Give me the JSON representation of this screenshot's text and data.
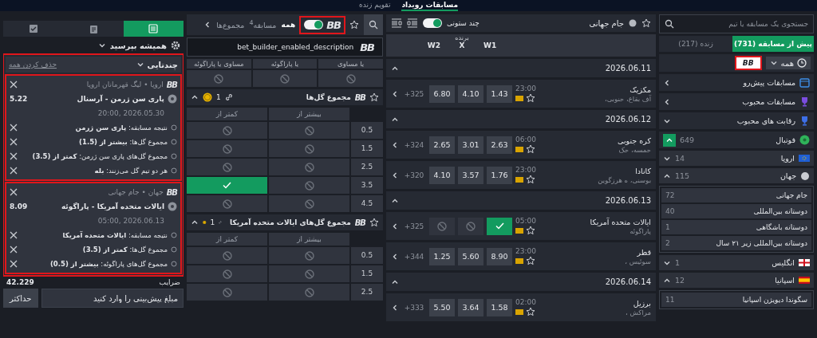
{
  "top_nav": {
    "tabs": [
      {
        "label": "مسابقات رویداد",
        "selected": true
      },
      {
        "label": "تقویم زنده",
        "selected": false
      }
    ]
  },
  "bet_slip": {
    "tabs": [
      {
        "selected": true
      },
      {
        "selected": false
      },
      {
        "selected": false
      }
    ],
    "accept_mode": "همیشه بپرسید",
    "bet_type": "چندتایی",
    "clear_all": "حذف کردن همه",
    "highlighted": true,
    "bets": [
      {
        "badge": "BB",
        "league": "اروپا • لیگ قهرمانان اروپا",
        "match": "پاری سن ژرمن - آرسنال",
        "odds": "5.22",
        "date": "2026.05.30 ,20:00",
        "highlighted": true,
        "selections": [
          "نتیجه مسابقه: **پاری سن ژرمن**",
          "مجموع گل‌ها: **بیشتر از (1.5)**",
          "مجموع گل‌های پاری سن ژرمن: **کمتر از (3.5)**",
          "هر دو تیم گل می‌زنند: **بله**"
        ]
      },
      {
        "badge": "BB",
        "league": "جهان • جام جهانی",
        "match": "ایالات متحده آمریکا - پاراگوئه",
        "odds": "8.09",
        "date": "2026.06.13 ,05:00",
        "highlighted": true,
        "selections": [
          "نتیجه مسابقه: **ایالات متحده آمریکا**",
          "مجموع گل‌ها: **کمتر از (3.5)**",
          "مجموع گل‌های پاراگوئه: **بیشتر از (0.5)**"
        ]
      }
    ],
    "odds_label": "ضرایب",
    "total_odds": "42.229",
    "stake": {
      "placeholder": "مبلغ پیش‌بینی را وارد کنید"
    },
    "max_button": "حداکثر"
  },
  "markets": {
    "badge": "BB",
    "bet_builder_on": true,
    "highlighted": true,
    "tabs": [
      {
        "label": "همه",
        "selected": true
      },
      {
        "label": "مسابقه$^{4}$",
        "selected": false
      },
      {
        "label": "مجموع‌ها",
        "selected": false
      }
    ],
    "description": {
      "badge": "BB",
      "text": "bet_builder_enabled_description"
    },
    "partial_table": {
      "columns": [
        "یا مساوی",
        "یا پاراگوئه",
        "مساوی یا پاراگوئه"
      ]
    },
    "groups": [
      {
        "badge": "BB",
        "title": "مجموع گل‌ها",
        "links": "1",
        "expanded": true,
        "columns": [
          "بیشتر از",
          "کمتر از"
        ],
        "rows": [
          {
            "line": "0.5",
            "cells": [
              {
                "selected": false
              },
              {
                "selected": false
              }
            ]
          },
          {
            "line": "1.5",
            "cells": [
              {
                "selected": false
              },
              {
                "selected": false
              }
            ]
          },
          {
            "line": "2.5",
            "cells": [
              {
                "selected": false
              },
              {
                "selected": false
              }
            ]
          },
          {
            "line": "3.5",
            "cells": [
              {
                "selected": false
              },
              {
                "selected": true
              }
            ]
          },
          {
            "line": "4.5",
            "cells": [
              {
                "selected": false
              },
              {
                "selected": false
              }
            ]
          }
        ]
      },
      {
        "badge": "BB",
        "title": "مجموع گل‌های ایالات متحده آمریکا",
        "links": "1",
        "expanded": true,
        "columns": [
          "بیشتر از",
          "کمتر از"
        ],
        "rows": [
          {
            "line": "0.5",
            "cells": [
              {
                "selected": false
              },
              {
                "selected": false
              }
            ]
          },
          {
            "line": "1.5",
            "cells": [
              {
                "selected": false
              },
              {
                "selected": false
              }
            ]
          },
          {
            "line": "2.5",
            "cells": [
              {
                "selected": false
              },
              {
                "selected": false
              }
            ]
          }
        ]
      }
    ]
  },
  "events": {
    "title": "جام جهانی",
    "multi_column_label": "چند ستونی",
    "multi_column": true,
    "winner_label": "برنده",
    "outcomes": [
      "W1",
      "X",
      "W2"
    ],
    "days": [
      {
        "date": "2026.06.11",
        "expanded": true,
        "matches": [
          {
            "home": "مکزیک",
            "away": "آف بقاع، حنوبی،",
            "time": "23:00",
            "more": "325+",
            "odds": [
              {
                "value": "1.43",
                "selected": false
              },
              {
                "value": "4.10",
                "selected": false
              },
              {
                "value": "6.80",
                "selected": false
              }
            ]
          }
        ]
      },
      {
        "date": "2026.06.12",
        "expanded": true,
        "matches": [
          {
            "home": "کره جنوبی",
            "away": "حمسه، حک",
            "time": "06:00",
            "more": "324+",
            "odds": [
              {
                "value": "2.63",
                "selected": false
              },
              {
                "value": "3.01",
                "selected": false
              },
              {
                "value": "2.65",
                "selected": false
              }
            ]
          },
          {
            "home": "کانادا",
            "away": "بوسنی، ه هرزگوین",
            "time": "23:00",
            "more": "320+",
            "odds": [
              {
                "value": "1.76",
                "selected": false
              },
              {
                "value": "3.57",
                "selected": false
              },
              {
                "value": "4.10",
                "selected": false
              }
            ]
          }
        ]
      },
      {
        "date": "2026.06.13",
        "expanded": true,
        "matches": [
          {
            "home": "ایالات متحده آمریکا",
            "away": "پاراگوئه",
            "time": "05:00",
            "more": "325+",
            "odds": [
              {
                "selected": true
              },
              {
                "selected": false
              },
              {
                "selected": false
              }
            ]
          },
          {
            "home": "قطر",
            "away": "سوئیس ،",
            "time": "23:00",
            "more": "344+",
            "odds": [
              {
                "value": "8.90",
                "selected": false
              },
              {
                "value": "5.60",
                "selected": false
              },
              {
                "value": "1.25",
                "selected": false
              }
            ]
          }
        ]
      },
      {
        "date": "2026.06.14",
        "expanded": true,
        "matches": [
          {
            "home": "برزیل",
            "away": "مراکش ،",
            "time": "02:00",
            "more": "333+",
            "odds": [
              {
                "value": "1.58",
                "selected": false
              },
              {
                "value": "3.64",
                "selected": false
              },
              {
                "value": "5.50",
                "selected": false
              }
            ]
          }
        ]
      }
    ]
  },
  "sidebar": {
    "search": {
      "placeholder": "جستجوی یک مسابقه یا تیم"
    },
    "tabs": [
      {
        "label": "پیش از مسابقه (731)",
        "selected": true
      },
      {
        "label": "زنده (217)",
        "selected": false
      }
    ],
    "period": "همه",
    "bb_filter": {
      "label": "BB",
      "highlighted": true
    },
    "menu": [
      {
        "label": "مسابقات پیش‌رو",
        "kind": "calendar",
        "expanded": false
      },
      {
        "label": "مسابقات محبوب",
        "kind": "trophy",
        "expanded": false
      },
      {
        "label": "رقابت های محبوب",
        "kind": "trophy",
        "expanded": true
      }
    ],
    "sports": [
      {
        "label": "فوتبال",
        "count": "649",
        "expanded": true,
        "children": [
          {
            "label": "اروپا",
            "count": "14",
            "kind": "europe",
            "expanded": false
          },
          {
            "label": "جهان",
            "count": "115",
            "kind": "world",
            "expanded": true,
            "children": [
              {
                "label": "جام جهانی",
                "count": "72"
              },
              {
                "label": "دوستانه بین‌المللی",
                "count": "40"
              },
              {
                "label": "دوستانه باشگاهی",
                "count": "1"
              },
              {
                "label": "دوستانه بین‌المللی زیر ۲۱ سال",
                "count": "2"
              }
            ]
          },
          {
            "label": "انگلیس",
            "count": "1",
            "kind": "england",
            "expanded": false
          },
          {
            "label": "اسپانیا",
            "count": "12",
            "kind": "spain",
            "expanded": true,
            "children": [
              {
                "label": "سگوندا دیویژن اسپانیا",
                "count": "11"
              }
            ]
          }
        ]
      }
    ]
  }
}
